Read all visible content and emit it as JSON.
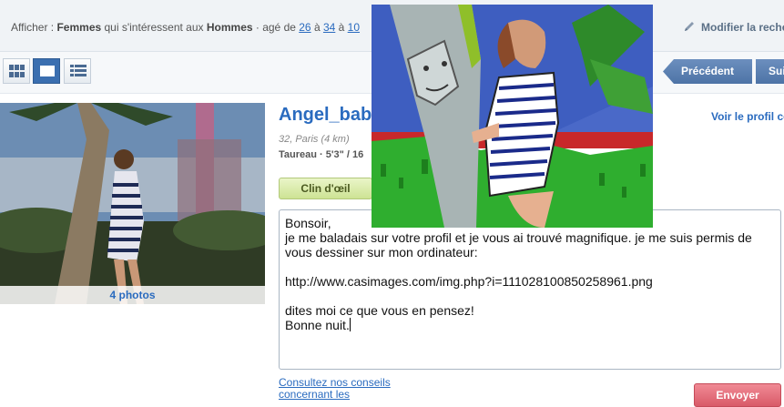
{
  "filter": {
    "prefix": "Afficher : ",
    "gender": "Femmes",
    "middle": " qui s'intéressent aux ",
    "target": "Hommes",
    "age_prefix": " · agé de ",
    "age_min": "26",
    "age_sep": " à ",
    "age_max": "34",
    "age_suffix": " à ",
    "distance_fragment": "10"
  },
  "modify_search": {
    "label": "Modifier la reche",
    "icon": "pencil-icon"
  },
  "toolbar": {
    "views": [
      {
        "name": "grid-view",
        "icon": "grid-icon",
        "active": false
      },
      {
        "name": "single-view",
        "icon": "single-card-icon",
        "active": true
      },
      {
        "name": "list-view",
        "icon": "list-icon",
        "active": false
      }
    ],
    "prev_label": "Précédent",
    "next_label": "Sui"
  },
  "profile": {
    "name": "Angel_babe",
    "meta": "32, Paris (4 km)",
    "details": "Taureau · 5'3\" / 16",
    "see_profile": "Voir le profil co",
    "photos_label": "4 photos",
    "wink_label": "Clin d'œil"
  },
  "message": {
    "lines": [
      "Bonsoir,",
      "je me baladais sur votre profil et je vous ai trouvé magnifique. je me suis permis de",
      "vous dessiner sur mon ordinateur:",
      "",
      "http://www.casimages.com/img.php?i=111028100850258961.png",
      "",
      "dites moi ce que vous en pensez!",
      "Bonne nuit."
    ]
  },
  "advice": {
    "line1": "Consultez nos conseils",
    "line2": "concernant les"
  },
  "send_label": "Envoyer",
  "colors": {
    "link": "#2a6bbf",
    "nav": "#4d73a6",
    "send": "#d95a68",
    "wink": "#cde394"
  }
}
